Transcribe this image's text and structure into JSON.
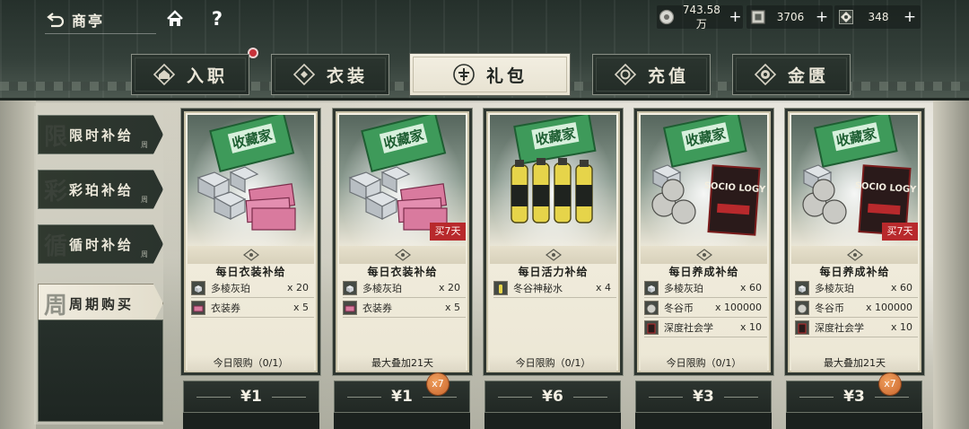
{
  "topbar": {
    "back_label": "商亭",
    "currencies": [
      {
        "icon": "silver-coin-icon",
        "value": "743.58万"
      },
      {
        "icon": "amber-token-icon",
        "value": "3706"
      },
      {
        "icon": "gem-icon",
        "value": "348"
      }
    ],
    "plus": "+",
    "help": "?"
  },
  "tabs": [
    {
      "label": "入职",
      "icon": "house-emblem-icon",
      "active": false
    },
    {
      "label": "衣装",
      "icon": "diamond-emblem-icon",
      "active": false
    },
    {
      "label": "礼包",
      "icon": "gift-emblem-icon",
      "active": true
    },
    {
      "label": "充值",
      "icon": "coin-emblem-icon",
      "active": false
    },
    {
      "label": "金匮",
      "icon": "chest-emblem-icon",
      "active": false
    }
  ],
  "sidemenu": [
    {
      "label": "限时补给",
      "hint": "周",
      "char": "限",
      "active": false
    },
    {
      "label": "彩珀补给",
      "hint": "周",
      "char": "彩",
      "active": false
    },
    {
      "label": "循时补给",
      "hint": "周",
      "char": "循",
      "active": false
    },
    {
      "label": "周期购买",
      "hint": "",
      "char": "周",
      "active": true
    }
  ],
  "cards": [
    {
      "title": "每日衣装补给",
      "art": "collector-box-crystals-tickets",
      "badge": "",
      "items": [
        {
          "name": "多棱灰珀",
          "qty": "x 20",
          "icon": "gray-amber-icon"
        },
        {
          "name": "衣装券",
          "qty": "x 5",
          "icon": "outfit-ticket-icon"
        }
      ],
      "footer": "今日限购（0/1）",
      "price": "¥1",
      "stack": ""
    },
    {
      "title": "每日衣装补给",
      "art": "collector-box-crystals-tickets",
      "badge": "买7天",
      "items": [
        {
          "name": "多棱灰珀",
          "qty": "x 20",
          "icon": "gray-amber-icon"
        },
        {
          "name": "衣装券",
          "qty": "x 5",
          "icon": "outfit-ticket-icon"
        }
      ],
      "footer": "最大叠加21天",
      "price": "¥1",
      "stack": "x7"
    },
    {
      "title": "每日活力补给",
      "art": "collector-box-bottles",
      "badge": "",
      "items": [
        {
          "name": "冬谷神秘水",
          "qty": "x 4",
          "icon": "mystery-water-icon"
        }
      ],
      "footer": "今日限购（0/1）",
      "price": "¥6",
      "stack": ""
    },
    {
      "title": "每日养成补给",
      "art": "collector-box-crystals-coins-book",
      "badge": "",
      "items": [
        {
          "name": "多棱灰珀",
          "qty": "x 60",
          "icon": "gray-amber-icon"
        },
        {
          "name": "冬谷币",
          "qty": "x 100000",
          "icon": "winter-coin-icon"
        },
        {
          "name": "深度社会学",
          "qty": "x 10",
          "icon": "sociology-book-icon"
        }
      ],
      "footer": "今日限购（0/1）",
      "price": "¥3",
      "stack": ""
    },
    {
      "title": "每日养成补给",
      "art": "collector-box-crystals-coins-book",
      "badge": "买7天",
      "items": [
        {
          "name": "多棱灰珀",
          "qty": "x 60",
          "icon": "gray-amber-icon"
        },
        {
          "name": "冬谷币",
          "qty": "x 100000",
          "icon": "winter-coin-icon"
        },
        {
          "name": "深度社会学",
          "qty": "x 10",
          "icon": "sociology-book-icon"
        }
      ],
      "footer": "最大叠加21天",
      "price": "¥3",
      "stack": "x7"
    }
  ],
  "art_text": {
    "box_label": "收藏家",
    "book_title": "SOCIO LOGY",
    "book_subtitle": "深度社会学"
  },
  "colors": {
    "accent_dark": "#2b352f",
    "paper": "#f3efe2",
    "badge_red": "#b8292c",
    "stack_orange": "#d9783d"
  }
}
